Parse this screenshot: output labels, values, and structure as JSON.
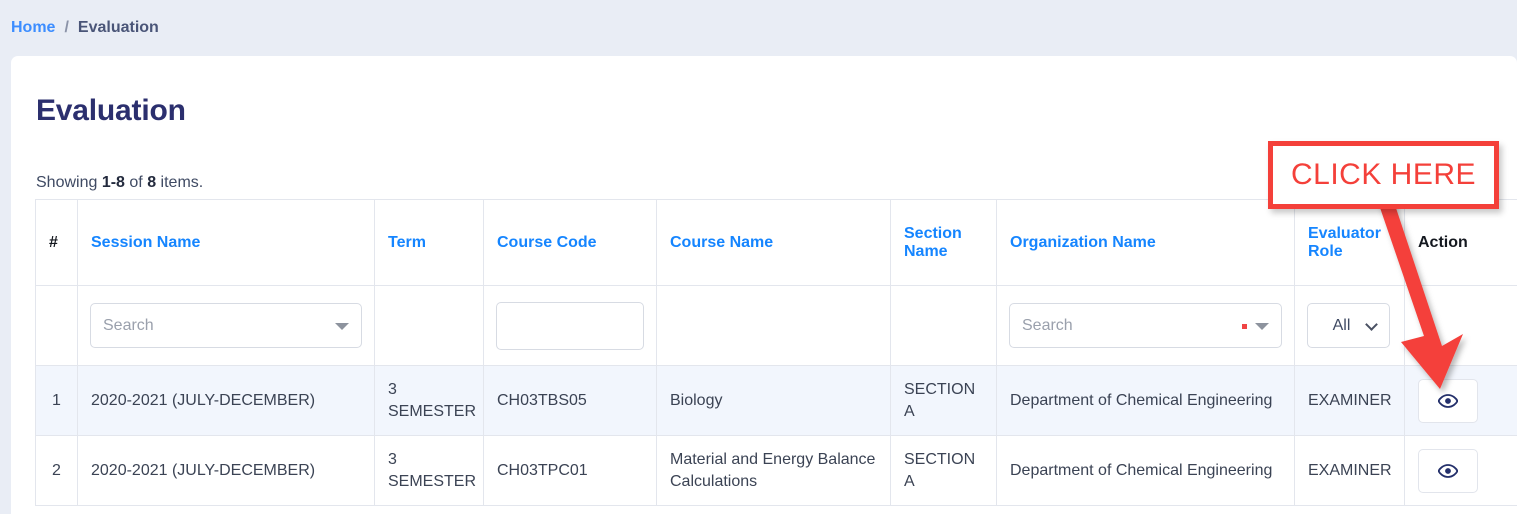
{
  "breadcrumb": {
    "home_label": "Home",
    "separator": "/",
    "current_label": "Evaluation"
  },
  "page": {
    "title": "Evaluation",
    "summary_prefix": "Showing ",
    "summary_range": "1-8",
    "summary_mid": " of ",
    "summary_total": "8",
    "summary_suffix": " items."
  },
  "annotation": {
    "label": "CLICK HERE",
    "color": "#f4403a"
  },
  "colors": {
    "page_bg": "#e9edf5",
    "card_bg": "#ffffff",
    "link_blue": "#1585ff",
    "breadcrumb_link": "#3c8dff",
    "title_navy": "#2b2f6e",
    "row_alt_bg": "#f2f6fd",
    "border": "#e3e6ed",
    "accent_red": "#f4403a",
    "eye_icon": "#24306b"
  },
  "table": {
    "columns": [
      {
        "label": "#",
        "sortable": false
      },
      {
        "label": "Session Name",
        "sortable": true
      },
      {
        "label": "Term",
        "sortable": true
      },
      {
        "label": "Course Code",
        "sortable": true
      },
      {
        "label": "Course Name",
        "sortable": true
      },
      {
        "label": "Section Name",
        "sortable": true
      },
      {
        "label": "Organization Name",
        "sortable": true
      },
      {
        "label": "Evaluator Role",
        "sortable": true
      },
      {
        "label": "Action",
        "sortable": false
      }
    ],
    "filters": {
      "session_name": {
        "type": "select2",
        "placeholder": "Search",
        "value": ""
      },
      "term": {
        "type": "none"
      },
      "course_code": {
        "type": "text",
        "placeholder": "",
        "value": ""
      },
      "course_name": {
        "type": "none"
      },
      "section_name": {
        "type": "none"
      },
      "organization_name": {
        "type": "select2",
        "placeholder": "Search",
        "value": ""
      },
      "evaluator_role": {
        "type": "select",
        "value": "All",
        "options": [
          "All"
        ]
      },
      "action": {
        "type": "none"
      }
    },
    "rows": [
      {
        "num": "1",
        "session_name": "2020-2021 (JULY-DECEMBER)",
        "term": "3 SEMESTER",
        "course_code": "CH03TBS05",
        "course_name": "Biology",
        "section_name": "SECTION A",
        "organization_name": "Department of Chemical Engineering",
        "evaluator_role": "EXAMINER",
        "action_icon": "eye-icon"
      },
      {
        "num": "2",
        "session_name": "2020-2021 (JULY-DECEMBER)",
        "term": "3 SEMESTER",
        "course_code": "CH03TPC01",
        "course_name": "Material and Energy Balance Calculations",
        "section_name": "SECTION A",
        "organization_name": "Department of Chemical Engineering",
        "evaluator_role": "EXAMINER",
        "action_icon": "eye-icon"
      }
    ]
  }
}
